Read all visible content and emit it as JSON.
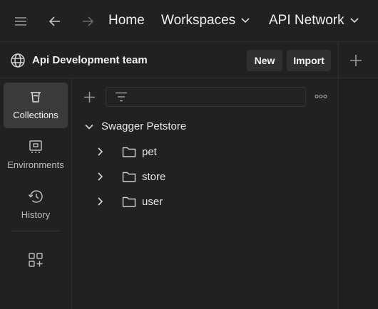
{
  "topbar": {
    "menu_icon": "hamburger-icon",
    "back_icon": "arrow-left-icon",
    "forward_icon": "arrow-right-icon",
    "home_label": "Home",
    "workspaces_label": "Workspaces",
    "api_network_label": "API Network"
  },
  "workspace": {
    "icon": "globe-icon",
    "title": "Api Development team",
    "new_label": "New",
    "import_label": "Import",
    "add_tab_icon": "plus-icon"
  },
  "sidebar": {
    "items": [
      {
        "label": "Collections",
        "icon": "trash-bin-icon",
        "active": true
      },
      {
        "label": "Environments",
        "icon": "environment-icon",
        "active": false
      },
      {
        "label": "History",
        "icon": "history-icon",
        "active": false
      }
    ],
    "add_apps_icon": "grid-plus-icon"
  },
  "collections": {
    "add_icon": "plus-icon",
    "filter_icon": "filter-icon",
    "search_placeholder": "",
    "more_icon": "more-dots-icon",
    "tree": {
      "name": "Swagger Petstore",
      "expanded": true,
      "folders": [
        "pet",
        "store",
        "user"
      ]
    }
  },
  "colors": {
    "background": "#212121",
    "active_item": "#3a3a3a",
    "text": "#e6e6e6",
    "muted_text": "#bdbdbd"
  }
}
